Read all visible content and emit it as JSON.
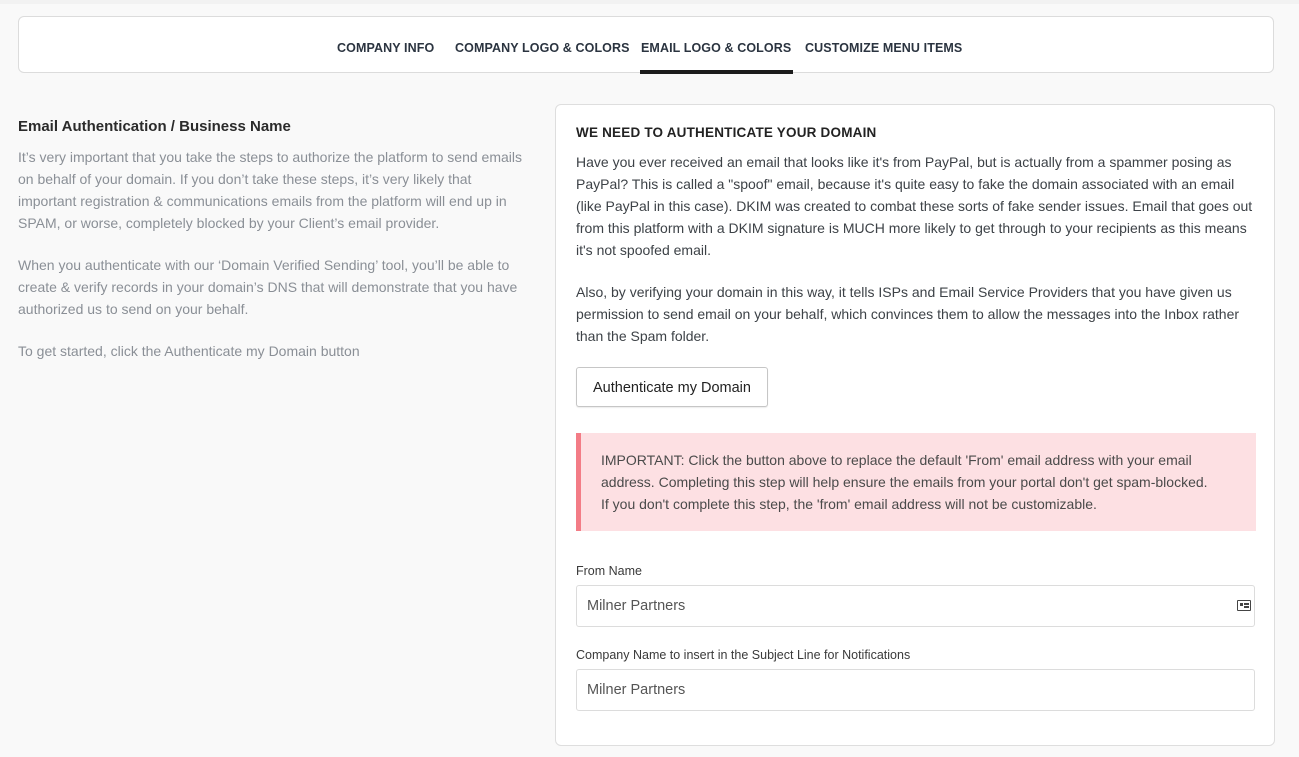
{
  "tabs": [
    {
      "label": "COMPANY INFO"
    },
    {
      "label": "COMPANY LOGO & COLORS"
    },
    {
      "label": "EMAIL LOGO & COLORS"
    },
    {
      "label": "CUSTOMIZE MENU ITEMS"
    }
  ],
  "active_tab": "EMAIL LOGO & COLORS",
  "left": {
    "title": "Email Authentication / Business Name",
    "paragraphs": [
      "It’s very important that you take the steps to authorize the platform to send emails on behalf of your domain. If you don’t take these steps, it’s very likely that important registration & communications emails from the platform will end up in SPAM, or worse, completely blocked by your Client’s email provider.",
      "When you authenticate with our ‘Domain Verified Sending’ tool, you’ll be able to create & verify records in your domain’s DNS that will demonstrate that you have authorized us to send on your behalf.",
      "To get started, click the Authenticate my Domain button"
    ]
  },
  "card": {
    "title": "WE NEED TO AUTHENTICATE YOUR DOMAIN",
    "paragraphs": [
      "Have you ever received an email that looks like it's from PayPal, but is actually from a spammer posing as PayPal? This is called a \"spoof\" email, because it's quite easy to fake the domain associated with an email (like PayPal in this case). DKIM was created to combat these sorts of fake sender issues. Email that goes out from this platform with a DKIM signature is MUCH more likely to get through to your recipients as this means it's not spoofed email.",
      "Also, by verifying your domain in this way, it tells ISPs and Email Service Providers that you have given us permission to send email on your behalf, which convinces them to allow the messages into the Inbox rather than the Spam folder."
    ],
    "authenticate_button": "Authenticate my Domain",
    "alert_lines": [
      "IMPORTANT: Click the button above to replace the default 'From' email address with your email",
      "address. Completing this step will help ensure the emails from your portal don't get spam-blocked.",
      "If you don't complete this step, the 'from' email address will not be customizable."
    ],
    "from_name": {
      "label": "From Name",
      "value": "Milner Partners",
      "icon": "contact-card-icon"
    },
    "company_subject": {
      "label": "Company Name to insert in the Subject Line for Notifications",
      "value": "Milner Partners"
    }
  },
  "colors": {
    "active_tab_underline": "#1c1c1c",
    "alert_background": "#fde0e3",
    "alert_border": "#f37c86",
    "left_text": "#8a8f96"
  }
}
